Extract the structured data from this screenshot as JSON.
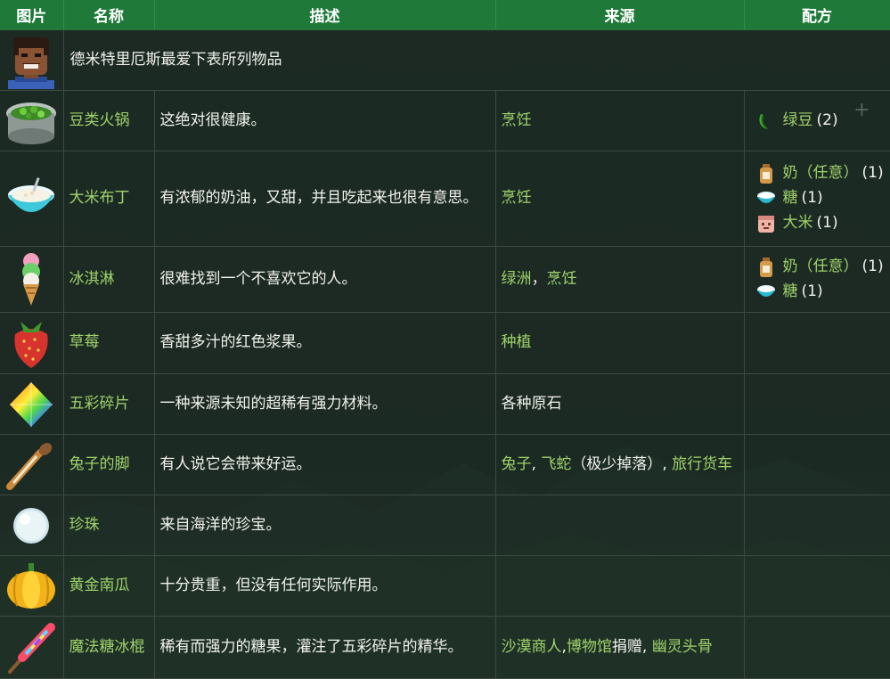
{
  "header": {
    "image": "图片",
    "name": "名称",
    "desc": "描述",
    "source": "来源",
    "recipe": "配方"
  },
  "intro": "德米特里厄斯最爱下表所列物品",
  "rows": [
    {
      "name": "豆类火锅",
      "desc": "这绝对很健康。",
      "source": [
        {
          "text": "烹饪",
          "link": true
        }
      ],
      "recipe": [
        {
          "name": "绿豆",
          "qty": "(2)",
          "icon": "green-bean-icon"
        }
      ]
    },
    {
      "name": "大米布丁",
      "desc": "有浓郁的奶油，又甜，并且吃起来也很有意思。",
      "source": [
        {
          "text": "烹饪",
          "link": true
        }
      ],
      "recipe": [
        {
          "name": "奶（任意）",
          "qty": "(1)",
          "icon": "milk-jug-icon"
        },
        {
          "name": "糖",
          "qty": "(1)",
          "icon": "sugar-icon"
        },
        {
          "name": "大米",
          "qty": "(1)",
          "icon": "rice-icon"
        }
      ]
    },
    {
      "name": "冰淇淋",
      "desc": "很难找到一个不喜欢它的人。",
      "source": [
        {
          "text": "绿洲",
          "link": true
        },
        {
          "text": "，",
          "link": false
        },
        {
          "text": "烹饪",
          "link": true
        }
      ],
      "recipe": [
        {
          "name": "奶（任意）",
          "qty": "(1)",
          "icon": "milk-jug-icon"
        },
        {
          "name": "糖",
          "qty": "(1)",
          "icon": "sugar-icon"
        }
      ]
    },
    {
      "name": "草莓",
      "desc": "香甜多汁的红色浆果。",
      "source": [
        {
          "text": "种植",
          "link": true
        }
      ],
      "recipe": []
    },
    {
      "name": "五彩碎片",
      "desc": "一种来源未知的超稀有强力材料。",
      "source": [
        {
          "text": "各种原石",
          "link": false
        }
      ],
      "recipe": []
    },
    {
      "name": "兔子的脚",
      "desc": "有人说它会带来好运。",
      "source": [
        {
          "text": "兔子",
          "link": true
        },
        {
          "text": ", ",
          "link": false
        },
        {
          "text": "飞蛇",
          "link": true
        },
        {
          "text": "（极少掉落）",
          "link": false
        },
        {
          "text": ", ",
          "link": false
        },
        {
          "text": "旅行货车",
          "link": true
        }
      ],
      "recipe": []
    },
    {
      "name": "珍珠",
      "desc": "来自海洋的珍宝。",
      "source": [],
      "recipe": []
    },
    {
      "name": "黄金南瓜",
      "desc": "十分贵重，但没有任何实际作用。",
      "source": [],
      "recipe": []
    },
    {
      "name": "魔法糖冰棍",
      "desc": "稀有而强力的糖果，灌注了五彩碎片的精华。",
      "source": [
        {
          "text": "沙漠商人",
          "link": true
        },
        {
          "text": ",",
          "link": false
        },
        {
          "text": "博物馆",
          "link": true
        },
        {
          "text": "捐赠",
          "link": false
        },
        {
          "text": ", ",
          "link": false
        },
        {
          "text": "幽灵头骨",
          "link": true
        }
      ],
      "recipe": []
    }
  ],
  "plus_glyph": "+",
  "colors": {
    "header_bg": "#1f7a3a",
    "link": "#9fd36a",
    "text": "#f2f2ec",
    "border": "#3d4a43"
  }
}
